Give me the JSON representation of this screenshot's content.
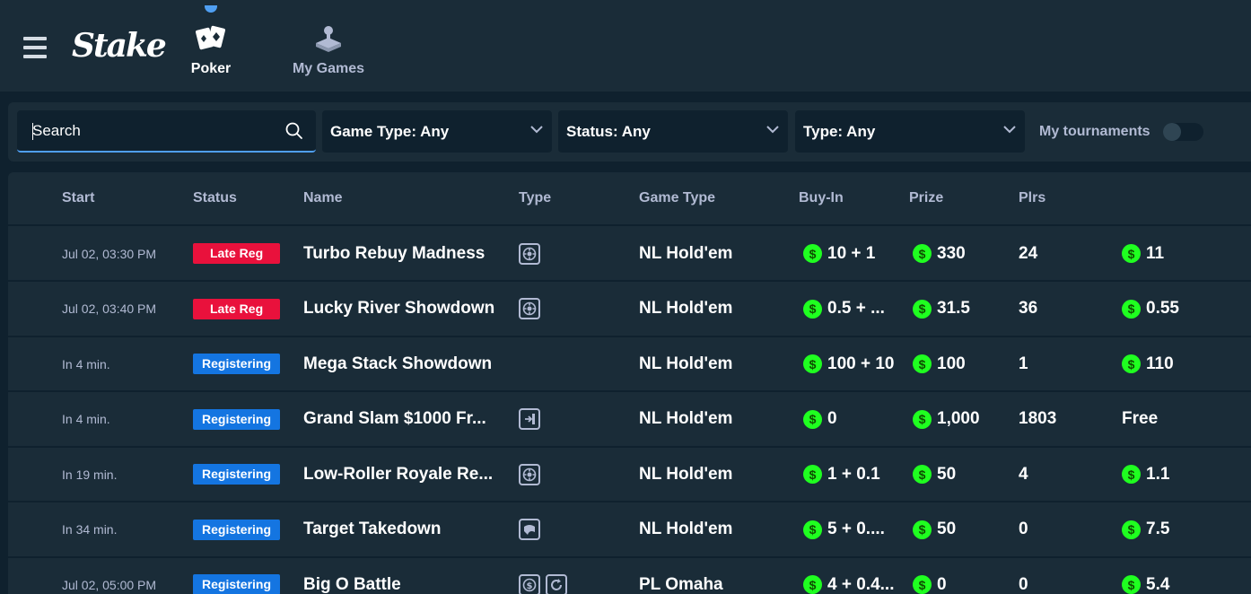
{
  "header": {
    "logo_text": "Stake",
    "nav": [
      {
        "label": "Poker",
        "icon": "playing-cards-icon",
        "active": true
      },
      {
        "label": "My Games",
        "icon": "joystick-icon",
        "active": false
      }
    ]
  },
  "filters": {
    "search_placeholder": "Search",
    "game_type": "Game Type: Any",
    "status": "Status: Any",
    "type": "Type: Any",
    "my_tournaments_label": "My tournaments",
    "my_tournaments_on": false
  },
  "table": {
    "headers": {
      "start": "Start",
      "status": "Status",
      "name": "Name",
      "type": "Type",
      "game_type": "Game Type",
      "buy_in": "Buy-In",
      "prize": "Prize",
      "plrs": "Plrs"
    },
    "rows": [
      {
        "start": "Jul 02, 03:30 PM",
        "status": "Late Reg",
        "status_kind": "late",
        "name": "Turbo Rebuy Madness",
        "type_icons": [
          "chip-icon"
        ],
        "game_type": "NL Hold'em",
        "buy_in": "10 + 1",
        "prize": "330",
        "plrs": "24",
        "extra": "11",
        "extra_coin": true
      },
      {
        "start": "Jul 02, 03:40 PM",
        "status": "Late Reg",
        "status_kind": "late",
        "name": "Lucky River Showdown",
        "type_icons": [
          "chip-icon"
        ],
        "game_type": "NL Hold'em",
        "buy_in": "0.5 + ...",
        "prize": "31.5",
        "plrs": "36",
        "extra": "0.55",
        "extra_coin": true
      },
      {
        "start": "In 4 min.",
        "status": "Registering",
        "status_kind": "reg",
        "name": "Mega Stack Showdown",
        "type_icons": [],
        "game_type": "NL Hold'em",
        "buy_in": "100 + 10",
        "prize": "100",
        "plrs": "1",
        "extra": "110",
        "extra_coin": true
      },
      {
        "start": "In 4 min.",
        "status": "Registering",
        "status_kind": "reg",
        "name": "Grand Slam $1000 Fr...",
        "type_icons": [
          "ticket-icon"
        ],
        "game_type": "NL Hold'em",
        "buy_in": "0",
        "prize": "1,000",
        "plrs": "1803",
        "extra": "Free",
        "extra_coin": false
      },
      {
        "start": "In 19 min.",
        "status": "Registering",
        "status_kind": "reg",
        "name": "Low-Roller Royale Re...",
        "type_icons": [
          "chip-icon"
        ],
        "game_type": "NL Hold'em",
        "buy_in": "1 + 0.1",
        "prize": "50",
        "plrs": "4",
        "extra": "1.1",
        "extra_coin": true
      },
      {
        "start": "In 34 min.",
        "status": "Registering",
        "status_kind": "reg",
        "name": "Target Takedown",
        "type_icons": [
          "bounty-icon"
        ],
        "game_type": "NL Hold'em",
        "buy_in": "5 + 0....",
        "prize": "50",
        "plrs": "0",
        "extra": "7.5",
        "extra_coin": true
      },
      {
        "start": "Jul 02, 05:00 PM",
        "status": "Registering",
        "status_kind": "reg",
        "name": "Big O Battle",
        "type_icons": [
          "dollar-chip-icon",
          "refresh-icon"
        ],
        "game_type": "PL Omaha",
        "buy_in": "4 + 0.4...",
        "prize": "0",
        "plrs": "0",
        "extra": "5.4",
        "extra_coin": true
      }
    ]
  },
  "colors": {
    "background": "#0f212e",
    "panel": "#1a2c38",
    "accent": "#4f9ff2",
    "late_reg": "#e9113c",
    "registering": "#1475e1",
    "coin": "#1fff20",
    "muted_text": "#b1bad3"
  }
}
